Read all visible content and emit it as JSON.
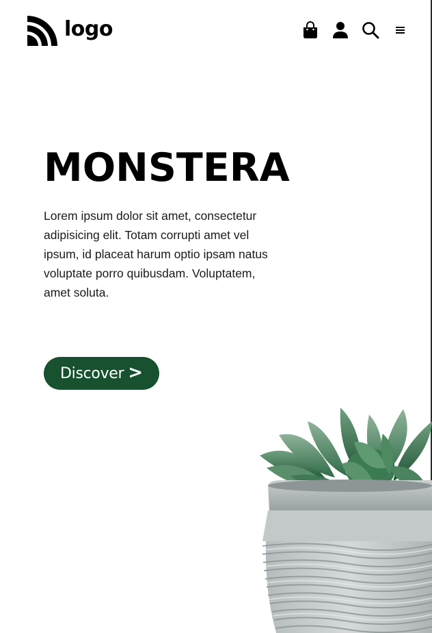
{
  "header": {
    "logo_text": "logo",
    "icons": [
      "bag-icon",
      "user-icon",
      "search-icon",
      "menu-icon"
    ]
  },
  "hero": {
    "title": "MONSTERA",
    "description": "Lorem ipsum dolor sit amet, consectetur adipisicing elit. Totam corrupti amet vel ipsum, id placeat harum optio ipsam natus voluptate porro quibusdam. Voluptatem, amet soluta.",
    "cta_label": "Discover",
    "cta_arrow": ">"
  },
  "colors": {
    "accent": "#17512f",
    "text": "#000000",
    "background": "#ffffff"
  },
  "illustration": "potted-succulent"
}
